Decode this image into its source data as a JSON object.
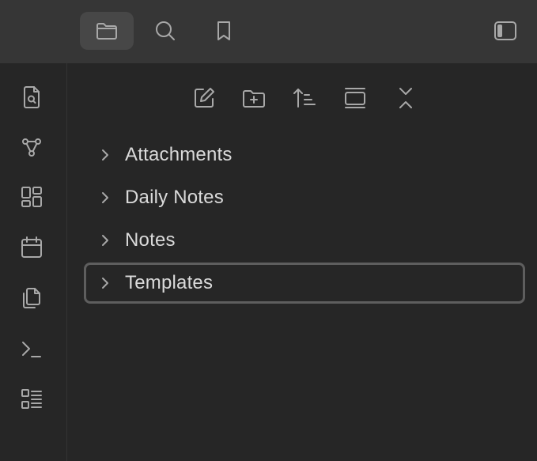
{
  "topbar": {
    "tabs": [
      {
        "icon": "folder-icon",
        "active": true
      },
      {
        "icon": "search-icon",
        "active": false
      },
      {
        "icon": "bookmark-icon",
        "active": false
      }
    ],
    "sidebar_toggle_icon": "sidebar-toggle-icon"
  },
  "ribbon": {
    "items": [
      {
        "icon": "file-search-icon"
      },
      {
        "icon": "graph-icon"
      },
      {
        "icon": "dashboard-icon"
      },
      {
        "icon": "calendar-icon"
      },
      {
        "icon": "copy-icon"
      },
      {
        "icon": "terminal-icon"
      },
      {
        "icon": "list-icon"
      }
    ]
  },
  "file_explorer": {
    "actions": [
      {
        "icon": "new-note-icon"
      },
      {
        "icon": "new-folder-icon"
      },
      {
        "icon": "sort-icon"
      },
      {
        "icon": "auto-reveal-icon"
      },
      {
        "icon": "collapse-all-icon"
      }
    ],
    "folders": [
      {
        "label": "Attachments"
      },
      {
        "label": "Daily Notes"
      },
      {
        "label": "Notes"
      },
      {
        "label": "Templates"
      }
    ]
  },
  "colors": {
    "background": "#262626",
    "topbar": "#363636",
    "active_tab": "#474747",
    "icon": "#a8a8a8",
    "text": "#dadada",
    "focus_border": "#5e5e5e"
  }
}
